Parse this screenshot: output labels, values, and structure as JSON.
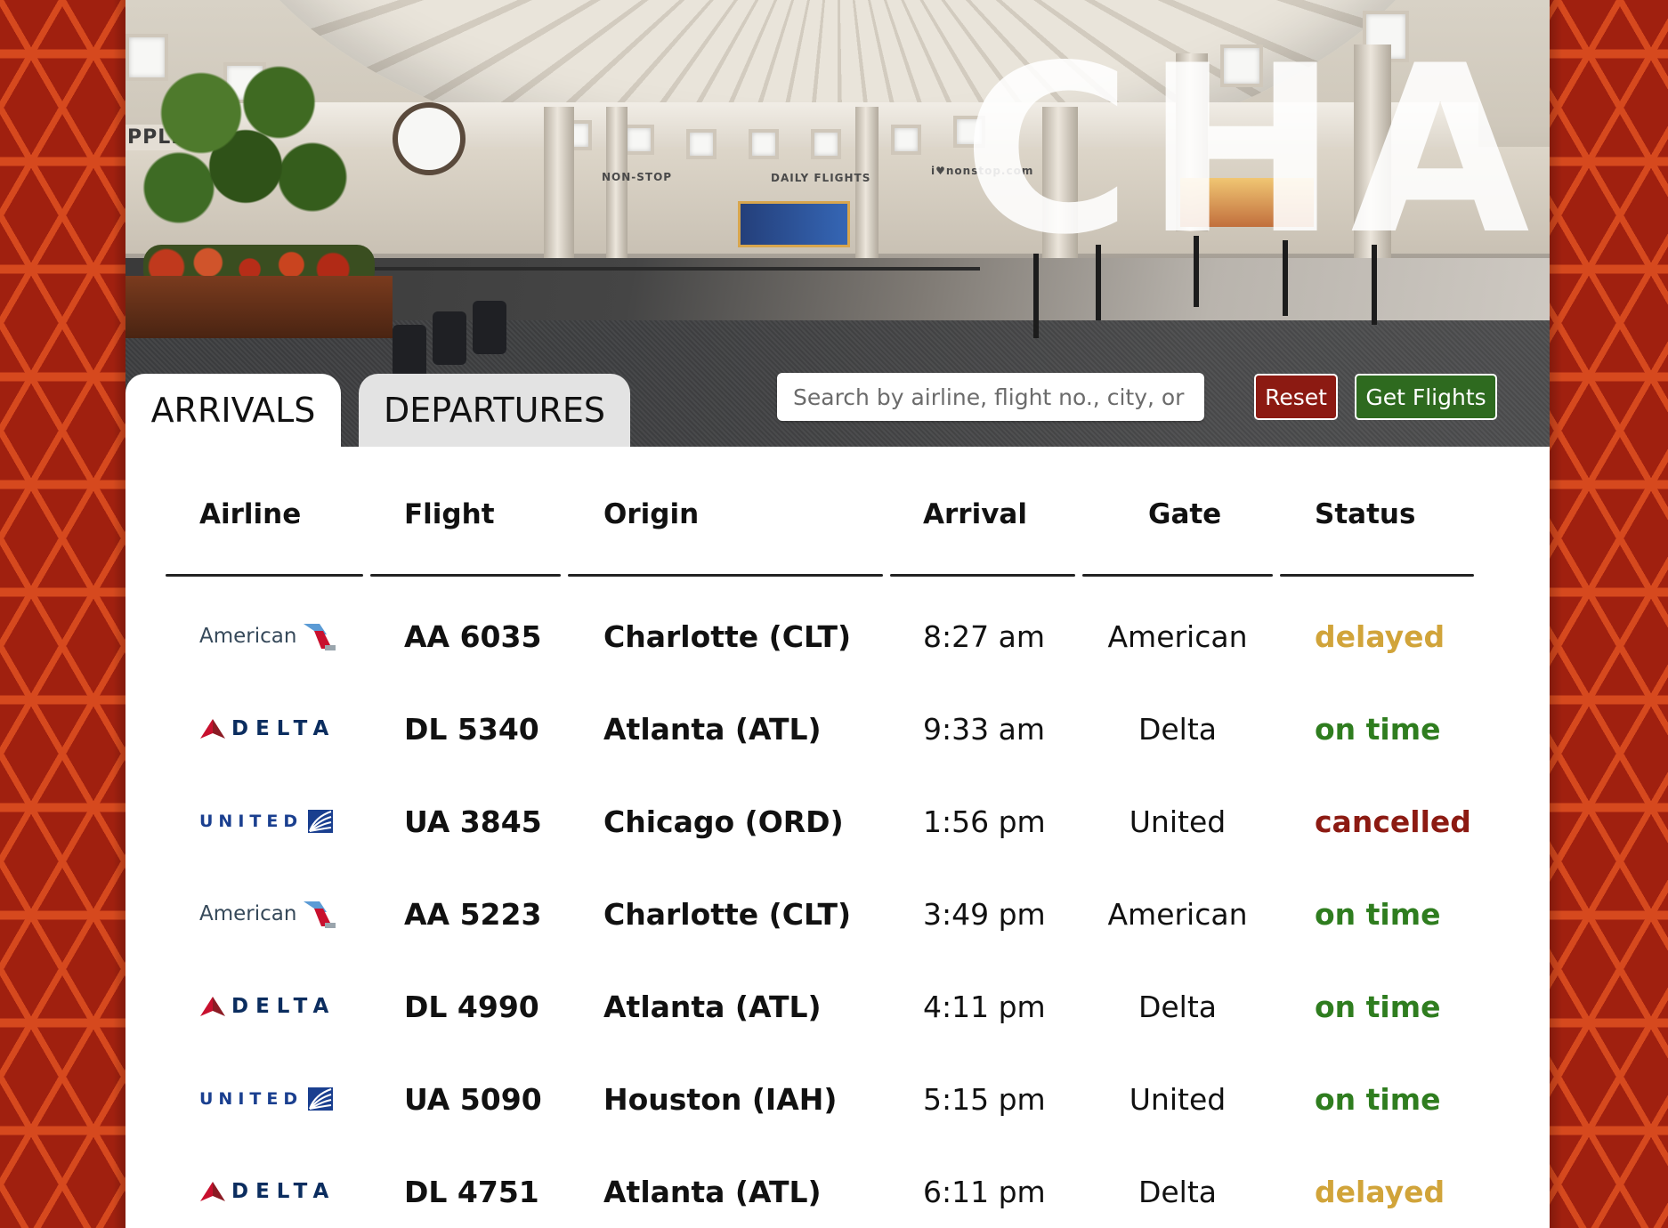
{
  "hero": {
    "title": "CHA",
    "signs": {
      "pple": "PPLE",
      "nonstop": "NON-STOP",
      "daily": "DAILY FLIGHTS",
      "ilove": "i♥nonstop.com"
    }
  },
  "tabs": [
    {
      "label": "ARRIVALS",
      "active": true
    },
    {
      "label": "DEPARTURES",
      "active": false
    }
  ],
  "search": {
    "placeholder": "Search by airline, flight no., city, or status",
    "value": ""
  },
  "buttons": {
    "reset": "Reset",
    "get_flights": "Get Flights"
  },
  "colors": {
    "reset_bg": "#8c1a12",
    "get_flights_bg": "#2e6a1f",
    "status_delayed": "#d1a43a",
    "status_on_time": "#2f7d1f",
    "status_cancelled": "#8c1a12"
  },
  "table": {
    "headers": {
      "airline": "Airline",
      "flight": "Flight",
      "origin": "Origin",
      "arrival": "Arrival",
      "gate": "Gate",
      "status": "Status"
    },
    "rows": [
      {
        "airline": "American",
        "logo": "american-logo-icon",
        "flight": "AA 6035",
        "origin": "Charlotte (CLT)",
        "arrival": "8:27 am",
        "gate": "American",
        "status": "delayed"
      },
      {
        "airline": "DELTA",
        "logo": "delta-logo-icon",
        "flight": "DL 5340",
        "origin": "Atlanta (ATL)",
        "arrival": "9:33 am",
        "gate": "Delta",
        "status": "on time"
      },
      {
        "airline": "UNITED",
        "logo": "united-logo-icon",
        "flight": "UA 3845",
        "origin": "Chicago (ORD)",
        "arrival": "1:56 pm",
        "gate": "United",
        "status": "cancelled"
      },
      {
        "airline": "American",
        "logo": "american-logo-icon",
        "flight": "AA 5223",
        "origin": "Charlotte (CLT)",
        "arrival": "3:49 pm",
        "gate": "American",
        "status": "on time"
      },
      {
        "airline": "DELTA",
        "logo": "delta-logo-icon",
        "flight": "DL 4990",
        "origin": "Atlanta (ATL)",
        "arrival": "4:11 pm",
        "gate": "Delta",
        "status": "on time"
      },
      {
        "airline": "UNITED",
        "logo": "united-logo-icon",
        "flight": "UA 5090",
        "origin": "Houston (IAH)",
        "arrival": "5:15 pm",
        "gate": "United",
        "status": "on time"
      },
      {
        "airline": "DELTA",
        "logo": "delta-logo-icon",
        "flight": "DL 4751",
        "origin": "Atlanta (ATL)",
        "arrival": "6:11 pm",
        "gate": "Delta",
        "status": "delayed"
      }
    ]
  }
}
